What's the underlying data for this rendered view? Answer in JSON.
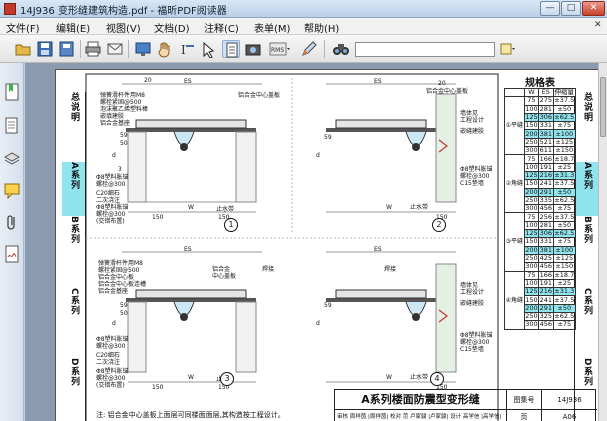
{
  "window": {
    "title": "14J936 变形缝建筑构造.pdf - 福昕PDF阅读器",
    "min_label": "—",
    "max_label": "□",
    "close_label": "✕"
  },
  "menu": {
    "items": [
      "文件(F)",
      "编辑(E)",
      "视图(V)",
      "文档(D)",
      "注释(C)",
      "表单(M)",
      "帮助(H)"
    ],
    "close_glyph": "✕"
  },
  "toolbar": {
    "icons": [
      "open-folder-icon",
      "save-icon",
      "save-as-icon",
      "print-icon",
      "email-icon",
      "screen-icon",
      "hand-tool-icon",
      "select-text-icon",
      "snapshot-icon",
      "page-view-icon",
      "camera-icon",
      "rms-icon",
      "pen-tool-icon",
      "find-binoculars-icon"
    ],
    "search_placeholder": ""
  },
  "sidebar": {
    "icons": [
      "bookmark-icon",
      "pages-icon",
      "layers-icon",
      "comments-icon",
      "attachments-icon",
      "signature-icon"
    ]
  },
  "document": {
    "left_bands": [
      {
        "text": "总说明"
      },
      {
        "text": "A系列"
      },
      {
        "text": "B系列"
      },
      {
        "text": "C系列"
      },
      {
        "text": "D系列"
      }
    ],
    "right_bands": [
      {
        "text": "总说明"
      },
      {
        "text": "A系列"
      },
      {
        "text": "B系列"
      },
      {
        "text": "C系列"
      },
      {
        "text": "D系列"
      }
    ],
    "spec_table": {
      "title": "规格表",
      "headers": [
        "",
        "W",
        "ES",
        "伸缩量"
      ],
      "groups": [
        {
          "label": "①平缝",
          "rows": [
            [
              "75",
              "275",
              "±37.5"
            ],
            [
              "100",
              "281",
              "±50"
            ],
            [
              "125",
              "306",
              "±62.5"
            ],
            [
              "150",
              "331",
              "±75"
            ],
            [
              "200",
              "381",
              "±100"
            ],
            [
              "250",
              "521",
              "±125"
            ],
            [
              "300",
              "611",
              "±150"
            ]
          ]
        },
        {
          "label": "②角缝",
          "rows": [
            [
              "75",
              "166",
              "±18.7"
            ],
            [
              "100",
              "191",
              "±25"
            ],
            [
              "125",
              "216",
              "±31.3"
            ],
            [
              "150",
              "241",
              "±37.5"
            ],
            [
              "200",
              "291",
              "±50"
            ],
            [
              "250",
              "335",
              "±62.5"
            ],
            [
              "300",
              "456",
              "±75"
            ]
          ]
        },
        {
          "label": "③平缝",
          "rows": [
            [
              "75",
              "256",
              "±37.5"
            ],
            [
              "100",
              "281",
              "±50"
            ],
            [
              "125",
              "306",
              "±62.5"
            ],
            [
              "150",
              "331",
              "±75"
            ],
            [
              "200",
              "381",
              "±100"
            ],
            [
              "250",
              "425",
              "±125"
            ],
            [
              "300",
              "456",
              "±150"
            ]
          ]
        },
        {
          "label": "④角缝",
          "rows": [
            [
              "75",
              "166",
              "±18.7"
            ],
            [
              "100",
              "191",
              "±25"
            ],
            [
              "125",
              "216",
              "±31.3"
            ],
            [
              "150",
              "241",
              "±37.5"
            ],
            [
              "200",
              "291",
              "±50"
            ],
            [
              "250",
              "325",
              "±62.5"
            ],
            [
              "300",
              "456",
              "±75"
            ]
          ]
        }
      ]
    },
    "details": [
      {
        "num": "1",
        "labels": [
          "弹簧滑杆件用M8",
          "螺栓紧固@500",
          "泡沫聚乙烯塑料棒",
          "嵌填建胶",
          "铝合金基座",
          "铝合金中心盖板",
          "ES",
          "20",
          "d",
          "50",
          "59",
          "3",
          "Φ8塑料胀锚",
          "螺栓@300",
          "C20细石",
          "二次浇注",
          "Φ8塑料胀锚",
          "螺栓@300",
          "(交错布置)",
          "W",
          "150",
          "150",
          "止水带"
        ]
      },
      {
        "num": "2",
        "labels": [
          "铝合金中心盖板",
          "ES",
          "20",
          "墙体见",
          "工程设计",
          "嵌缝建胶",
          "Φ8塑料胀锚",
          "螺栓@300",
          "C15垫墙",
          "止水带",
          "W",
          "150",
          "d",
          "59"
        ]
      },
      {
        "num": "3",
        "labels": [
          "弹簧滑杆件用M8",
          "螺栓紧固@500",
          "铝合金中心板",
          "铝合金中心板连槽",
          "铝合金基座",
          "铝合金",
          "中心盖板",
          "焊接",
          "ES",
          "d",
          "50",
          "59",
          "Φ8塑料胀锚",
          "螺栓@300",
          "C20细石",
          "二次浇注",
          "Φ8塑料胀锚",
          "螺栓@300",
          "(交错布置)",
          "W",
          "150",
          "150",
          "止水带"
        ]
      },
      {
        "num": "4",
        "labels": [
          "焊接",
          "ES",
          "d",
          "59",
          "墙体见",
          "工程设计",
          "嵌缝建胶",
          "Φ8塑料胀锚",
          "螺栓@300",
          "C15垫墙",
          "止水带",
          "W",
          "150"
        ]
      }
    ],
    "note": "注: 铝合金中心盖板上面层可同楼面面层,其构造按工程设计。",
    "title_block": {
      "main_title": "A系列楼面防震型变形缝",
      "atlas_label": "图集号",
      "atlas_no": "14J936",
      "sign_row": "审核 周祥茵 |周祥茵| 校对 范 卢家骏 |卢家骏| 设计 高学信 |高学信|",
      "page_label": "页",
      "page_no": "A06"
    }
  }
}
